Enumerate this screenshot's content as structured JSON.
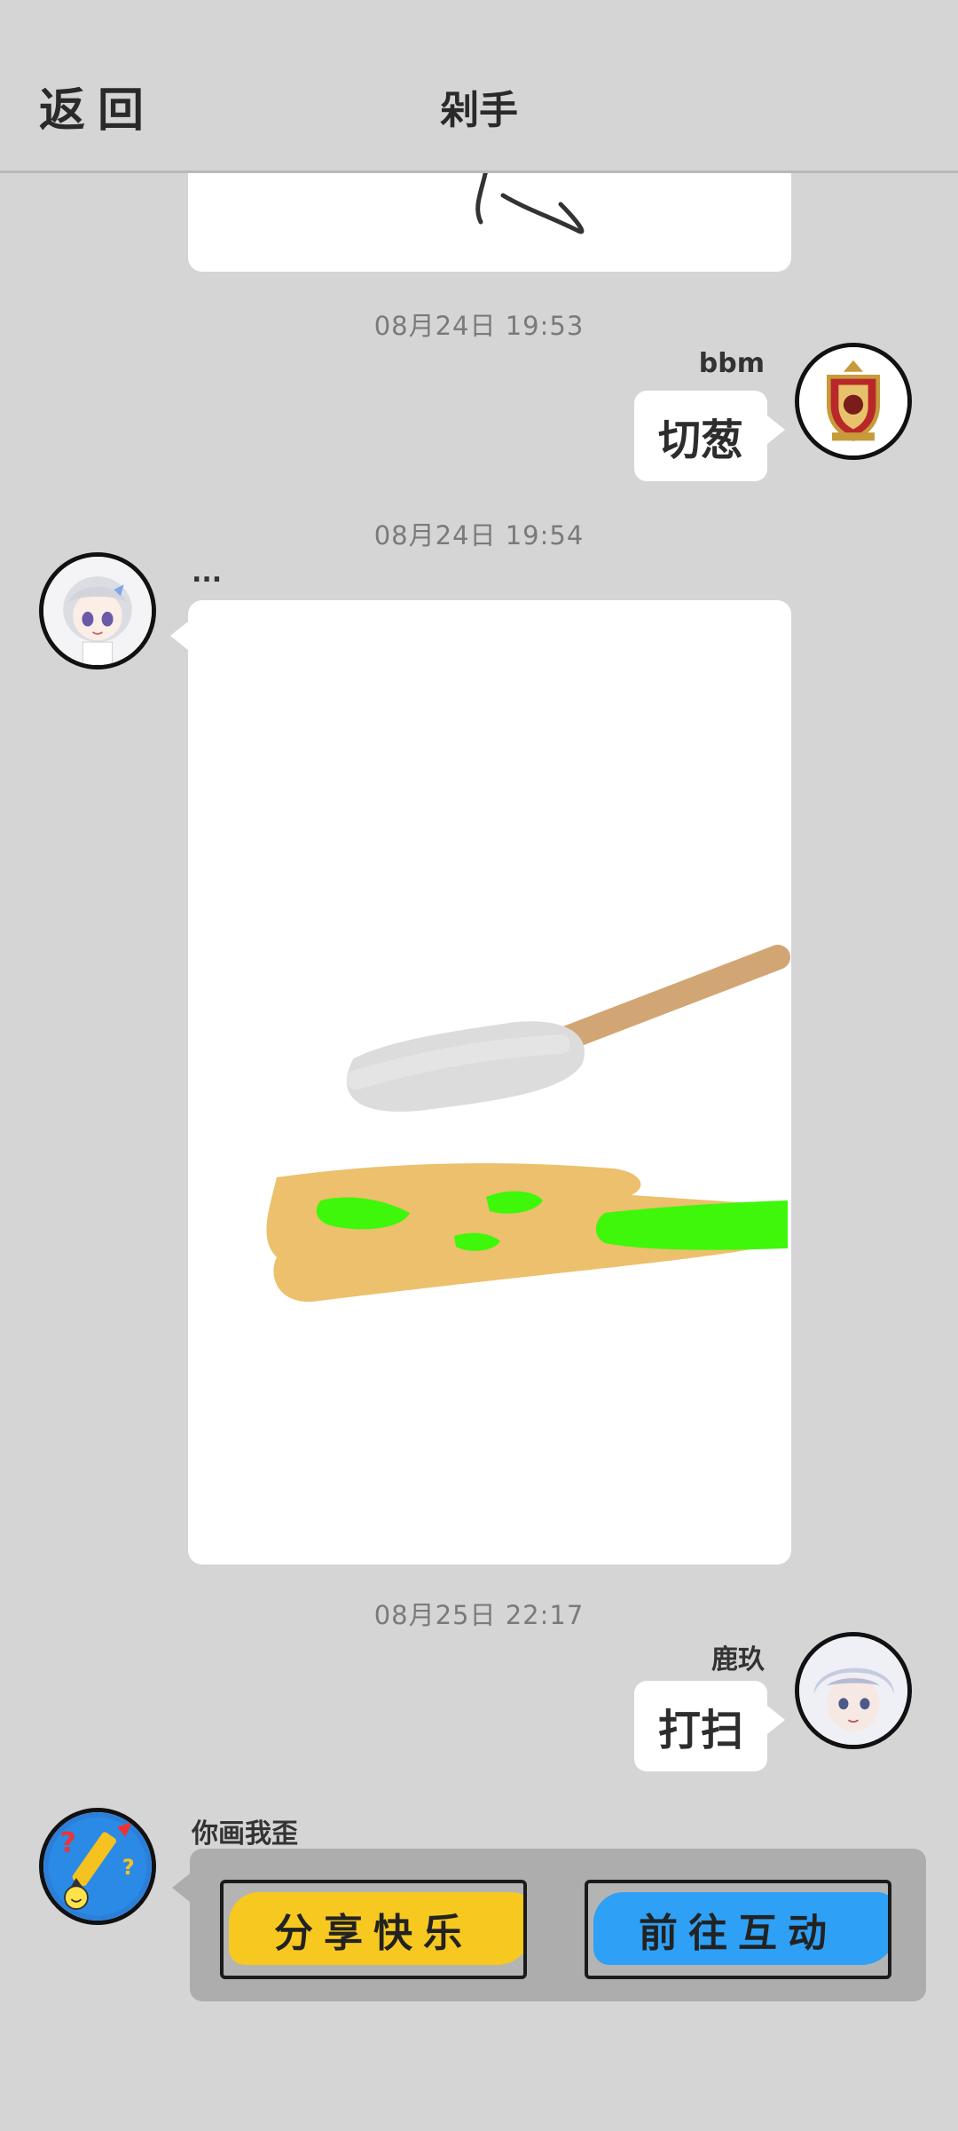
{
  "header": {
    "back_label": "返回",
    "title": "剁手"
  },
  "messages": [
    {
      "timestamp": "08月24日  19:53",
      "sender": "bbm",
      "text": "切葱"
    },
    {
      "timestamp": "08月24日  19:54",
      "sender": "..."
    },
    {
      "timestamp": "08月25日  22:17",
      "sender": "鹿玖",
      "text": "打扫"
    },
    {
      "sender": "你画我歪",
      "buttons": [
        {
          "label": "分享快乐",
          "color": "#f7c820"
        },
        {
          "label": "前往互动",
          "color": "#2ea0f5"
        }
      ]
    }
  ],
  "colors": {
    "background": "#d5d5d5",
    "bubble": "#ffffff",
    "card": "#adadad"
  }
}
